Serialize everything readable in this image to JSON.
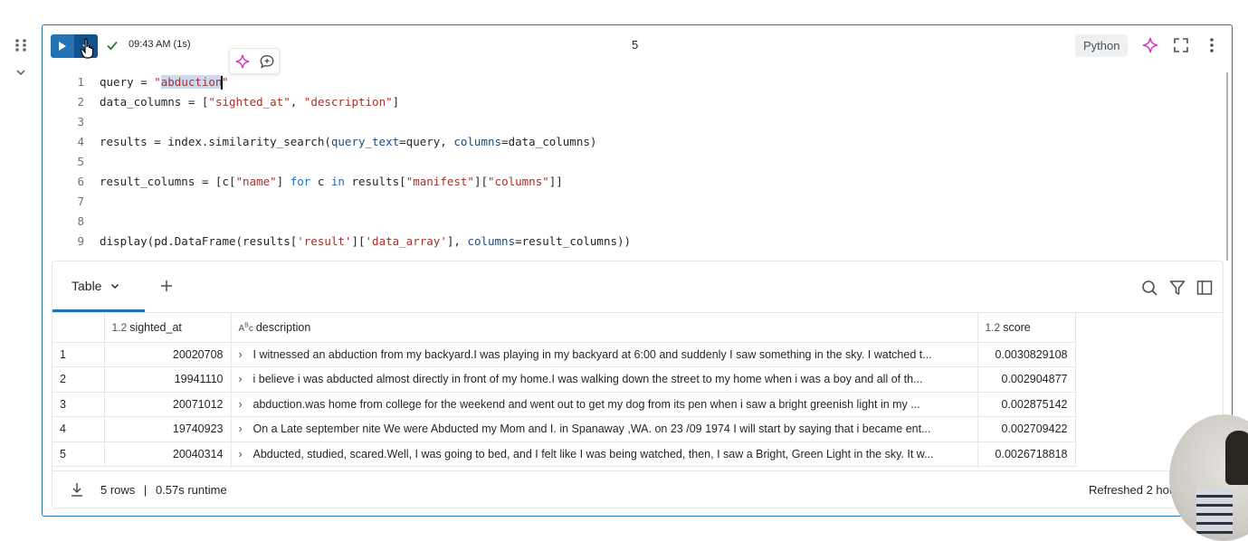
{
  "cell": {
    "run_time": "09:43 AM (1s)",
    "cell_number": "5",
    "language": "Python"
  },
  "code": {
    "line_numbers": [
      "1",
      "2",
      "3",
      "4",
      "5",
      "6",
      "7",
      "8",
      "9"
    ]
  },
  "results": {
    "tab_label": "Table",
    "columns": [
      {
        "type": "1.2",
        "name": "sighted_at"
      },
      {
        "type": "ABC",
        "name": "description"
      },
      {
        "type": "1.2",
        "name": "score"
      }
    ],
    "rows": [
      {
        "index": "1",
        "sighted_at": "20020708",
        "description": "I witnessed an abduction from my backyard.I was playing in my backyard at 6:00 and suddenly I saw something in the sky. I watched t...",
        "score": "0.0030829108"
      },
      {
        "index": "2",
        "sighted_at": "19941110",
        "description": "i believe i was abducted almost directly in front of my home.I was walking down the street to my home when i was a boy and all of th...",
        "score": "0.002904877"
      },
      {
        "index": "3",
        "sighted_at": "20071012",
        "description": "abduction.was home from college for the weekend and went out to get my dog from its pen when i saw a bright greenish light in my ...",
        "score": "0.002875142"
      },
      {
        "index": "4",
        "sighted_at": "19740923",
        "description": "On a Late september nite We were Abducted my Mom and I. in Spanaway ,WA. on 23 /09 1974 I will start by saying that i became ent...",
        "score": "0.002709422"
      },
      {
        "index": "5",
        "sighted_at": "20040314",
        "description": "Abducted, studied, scared.Well, I was going to bed, and I felt like I was being watched, then, I saw a Bright, Green Light in the sky. It w...",
        "score": "0.0026718818"
      }
    ],
    "footer_rows": "5 rows",
    "footer_sep": "|",
    "footer_runtime": "0.57s runtime",
    "refreshed": "Refreshed 2 hou"
  },
  "colors": {
    "accent": "#2272b4",
    "ai_sparkle": "#d13fbe",
    "success": "#277c43"
  },
  "icons": [
    "drag-handle-icon",
    "chevron-down-icon",
    "play-icon",
    "check-icon",
    "sparkle-icon",
    "fullscreen-icon",
    "kebab-menu-icon",
    "comment-icon",
    "plus-icon",
    "search-icon",
    "filter-icon",
    "sidebar-panel-icon",
    "download-icon"
  ]
}
